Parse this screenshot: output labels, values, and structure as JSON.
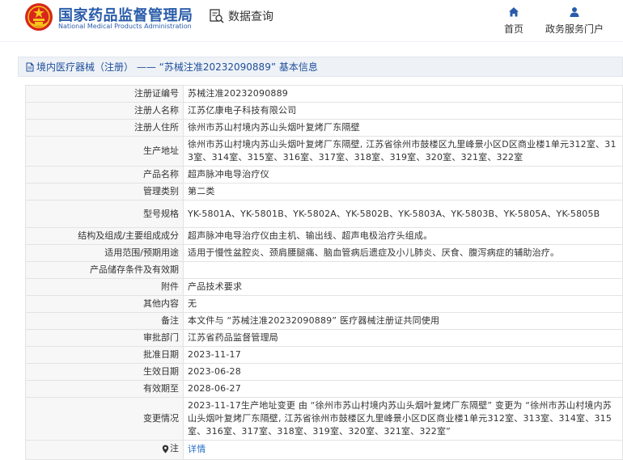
{
  "header": {
    "brand_cn": "国家药品监督管理局",
    "brand_en": "National Medical Products Administration",
    "query_label": "数据查询",
    "nav": [
      {
        "label": "首页",
        "icon": "home-icon"
      },
      {
        "label": "政务服务门户",
        "icon": "user-icon"
      }
    ]
  },
  "title_bar": {
    "text": "境内医疗器械（注册） —— “苏械注准20232090889” 基本信息"
  },
  "rows": [
    {
      "label": "注册证编号",
      "value": "苏械注准20232090889"
    },
    {
      "label": "注册人名称",
      "value": "江苏亿康电子科技有限公司"
    },
    {
      "label": "注册人住所",
      "value": "徐州市苏山村境内苏山头烟叶复烤厂东隔壁"
    },
    {
      "label": "生产地址",
      "value": "徐州市苏山村境内苏山头烟叶复烤厂东隔壁, 江苏省徐州市鼓楼区九里峰景小区D区商业楼1单元312室、313室、314室、315室、316室、317室、318室、319室、320室、321室、322室"
    },
    {
      "label": "产品名称",
      "value": "超声脉冲电导治疗仪"
    },
    {
      "label": "管理类别",
      "value": "第二类"
    },
    {
      "label": "型号规格",
      "value": "YK-5801A、YK-5801B、YK-5802A、YK-5802B、YK-5803A、YK-5803B、YK-5805A、YK-5805B"
    },
    {
      "label": "结构及组成/主要组成成分",
      "value": "超声脉冲电导治疗仪由主机、输出线、超声电极治疗头组成。"
    },
    {
      "label": "适用范围/预期用途",
      "value": "适用于慢性盆腔炎、颈肩腰腿痛、脑血管病后遗症及小儿肺炎、厌食、腹泻病症的辅助治疗。"
    },
    {
      "label": "产品储存条件及有效期",
      "value": ""
    },
    {
      "label": "附件",
      "value": "产品技术要求"
    },
    {
      "label": "其他内容",
      "value": "无"
    },
    {
      "label": "备注",
      "value": "本文件与 “苏械注准20232090889” 医疗器械注册证共同使用"
    },
    {
      "label": "审批部门",
      "value": "江苏省药品监督管理局"
    },
    {
      "label": "批准日期",
      "value": "2023-11-17"
    },
    {
      "label": "生效日期",
      "value": "2023-06-28"
    },
    {
      "label": "有效期至",
      "value": "2028-06-27"
    },
    {
      "label": "变更情况",
      "value": "2023-11-17生产地址变更 由 “徐州市苏山村境内苏山头烟叶复烤厂东隔壁” 变更为 “徐州市苏山村境内苏山头烟叶复烤厂东隔壁, 江苏省徐州市鼓楼区九里峰景小区D区商业楼1单元312室、313室、314室、315室、316室、317室、318室、319室、320室、321室、322室”"
    }
  ],
  "note_row": {
    "label": "注",
    "link_text": "详情"
  },
  "colors": {
    "brand_blue": "#2a5caa",
    "link_blue": "#2a6fc9",
    "label_bg": "#f7f7f7",
    "title_bg": "#eef2f7"
  }
}
